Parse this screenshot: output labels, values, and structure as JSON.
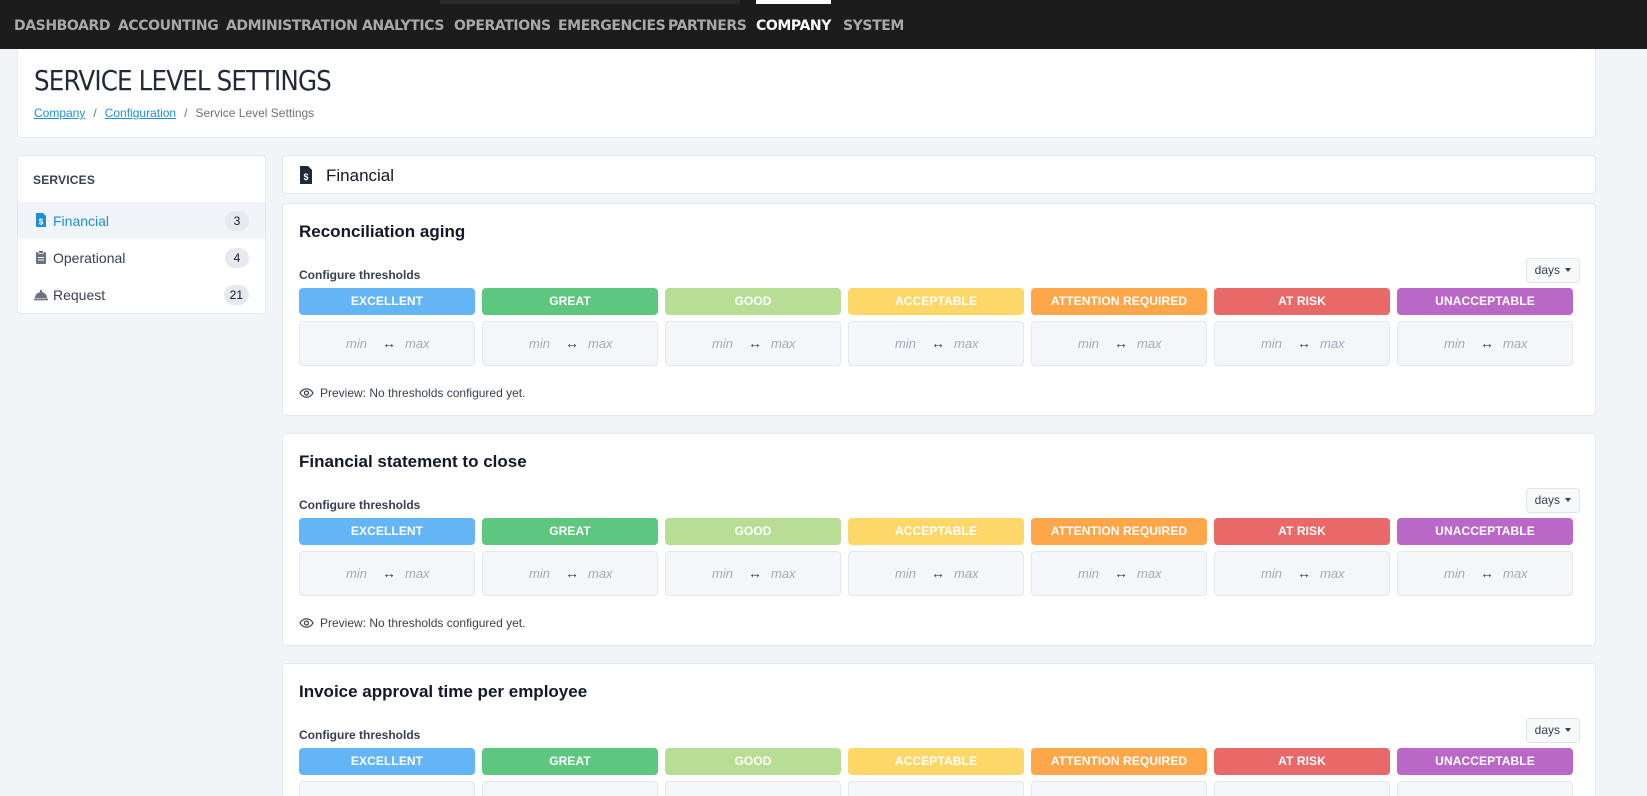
{
  "nav": [
    {
      "label": "DASHBOARD"
    },
    {
      "label": "ACCOUNTING"
    },
    {
      "label": "ADMINISTRATION"
    },
    {
      "label": "ANALYTICS"
    },
    {
      "label": "OPERATIONS"
    },
    {
      "label": "EMERGENCIES"
    },
    {
      "label": "PARTNERS"
    },
    {
      "label": "COMPANY",
      "active": true
    },
    {
      "label": "SYSTEM"
    }
  ],
  "header": {
    "title": "SERVICE LEVEL SETTINGS",
    "breadcrumb": [
      {
        "label": "Company",
        "link": true
      },
      {
        "label": "Configuration",
        "link": true
      },
      {
        "label": "Service Level Settings",
        "link": false
      }
    ]
  },
  "sidebar": {
    "title": "SERVICES",
    "items": [
      {
        "label": "Financial",
        "count": "3",
        "icon": "file-invoice-dollar-icon",
        "active": true
      },
      {
        "label": "Operational",
        "count": "4",
        "icon": "clipboard-icon"
      },
      {
        "label": "Request",
        "count": "21",
        "icon": "concierge-bell-icon"
      }
    ]
  },
  "panel": {
    "title": "Financial",
    "icon": "file-invoice-dollar-icon"
  },
  "tiers": [
    {
      "label": "EXCELLENT",
      "color": "#64b5f6"
    },
    {
      "label": "GREAT",
      "color": "#5ec77f"
    },
    {
      "label": "GOOD",
      "color": "#b7de94"
    },
    {
      "label": "ACCEPTABLE",
      "color": "#fdd869"
    },
    {
      "label": "ATTENTION REQUIRED",
      "color": "#fda64a"
    },
    {
      "label": "AT RISK",
      "color": "#e96868"
    },
    {
      "label": "UNACCEPTABLE",
      "color": "#ba68c8"
    }
  ],
  "range_placeholders": {
    "min": "min",
    "max": "max",
    "arrow": "↔"
  },
  "configure_label": "Configure thresholds",
  "cards": [
    {
      "title": "Reconciliation aging",
      "unit": "days",
      "preview": "Preview: No thresholds configured yet."
    },
    {
      "title": "Financial statement to close",
      "unit": "days",
      "preview": "Preview: No thresholds configured yet."
    },
    {
      "title": "Invoice approval time per employee",
      "unit": "days",
      "preview": ""
    }
  ]
}
